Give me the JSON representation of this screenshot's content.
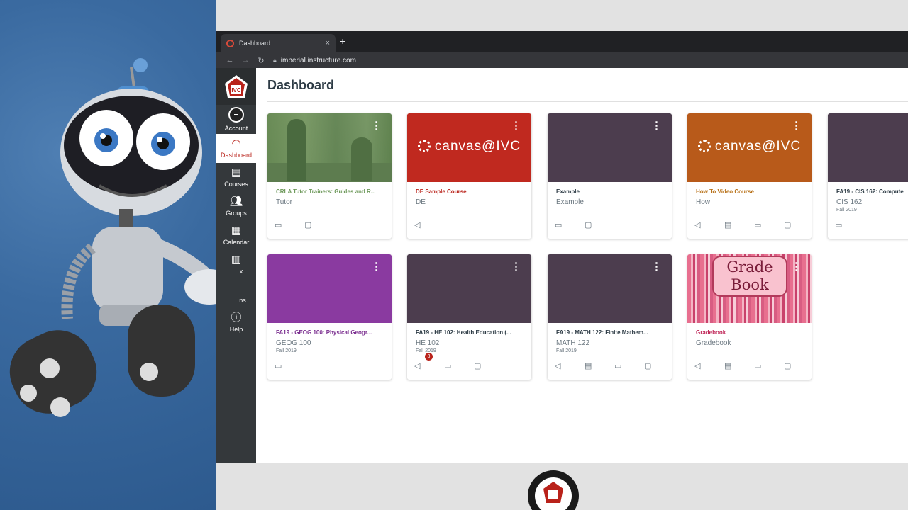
{
  "browser": {
    "tab_title": "Dashboard",
    "tab_close": "×",
    "new_tab": "+",
    "url": "imperial.instructure.com"
  },
  "nav": {
    "items": [
      {
        "label": "Account"
      },
      {
        "label": "Dashboard"
      },
      {
        "label": "Courses"
      },
      {
        "label": "Groups"
      },
      {
        "label": "Calendar"
      },
      {
        "label": "Inbox",
        "visible_text": "x"
      },
      {
        "label": "Commons",
        "visible_text": "ns"
      },
      {
        "label": "Help"
      }
    ]
  },
  "page": {
    "title": "Dashboard"
  },
  "cards": [
    {
      "name": "CRLA Tutor Trainers: Guides and R...",
      "code": "Tutor",
      "term": "",
      "color": "#5a8a4a",
      "name_color": "#6f9a5c"
    },
    {
      "name": "DE Sample Course",
      "code": "DE",
      "term": "",
      "color": "#c0291f",
      "name_color": "#b9221a",
      "hero_text": "canvas@IVC"
    },
    {
      "name": "Example",
      "code": "Example",
      "term": "",
      "color": "#4c3d4e",
      "name_color": "#2d3b45"
    },
    {
      "name": "How To Video Course",
      "code": "How",
      "term": "",
      "color": "#b85a1a",
      "name_color": "#b8721a",
      "hero_text": "canvas@IVC"
    },
    {
      "name": "FA19 - CIS 162: Compute",
      "code": "CIS 162",
      "term": "Fall 2019",
      "color": "#4c3d4e",
      "name_color": "#2d3b45"
    },
    {
      "name": "FA19 - GEOG 100: Physical Geogr...",
      "code": "GEOG 100",
      "term": "Fall 2019",
      "color": "#8a3aa0",
      "name_color": "#7a2d8f"
    },
    {
      "name": "FA19 - HE 102: Health Education (...",
      "code": "HE 102",
      "term": "Fall 2019",
      "color": "#4c3d4e",
      "name_color": "#2d3b45",
      "badge": "3"
    },
    {
      "name": "FA19 - MATH 122: Finite Mathem...",
      "code": "MATH 122",
      "term": "Fall 2019",
      "color": "#4c3d4e",
      "name_color": "#2d3b45"
    },
    {
      "name": "Gradebook",
      "code": "Gradebook",
      "term": "",
      "color": "#e8708f",
      "name_color": "#c0295a",
      "hero_text_1": "Grade",
      "hero_text_2": "Book"
    }
  ],
  "icons": {
    "announcement": "📢",
    "assignment": "📝",
    "discussion": "💬",
    "files": "📁",
    "kebab": "⋮"
  }
}
